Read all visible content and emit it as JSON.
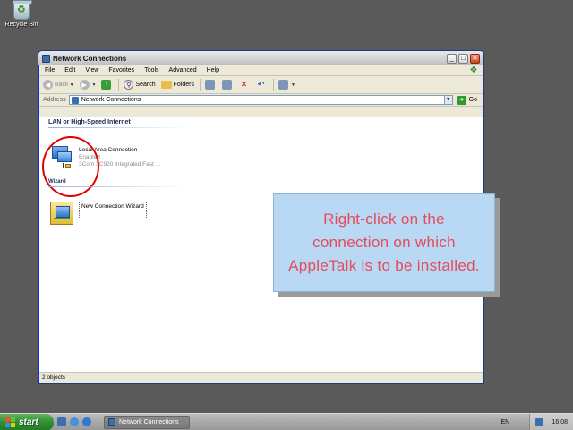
{
  "desktop": {
    "recycle_bin_label": "Recycle Bin",
    "recycle_bin_icon": "recycle-bin-icon"
  },
  "window": {
    "title": "Network Connections",
    "controls": {
      "minimize": "_",
      "maximize": "□",
      "close": "✕"
    }
  },
  "menubar": {
    "file": "File",
    "edit": "Edit",
    "view": "View",
    "favorites": "Favorites",
    "tools": "Tools",
    "advanced": "Advanced",
    "help": "Help"
  },
  "toolbar": {
    "back_label": "Back",
    "search_label": "Search",
    "folders_label": "Folders"
  },
  "addressbar": {
    "label": "Address",
    "value": "Network Connections",
    "go_label": "Go"
  },
  "content": {
    "group_lan": "LAN or High-Speed Internet",
    "group_wizard": "Wizard",
    "lan_connection": {
      "name": "Local Area Connection",
      "status": "Enabled",
      "device": "3Com 3C920 Integrated Fast ..."
    },
    "wizard_item": {
      "name": "New Connection Wizard"
    }
  },
  "callout": {
    "text": "Right-click on the connection on which AppleTalk is to be installed.",
    "text_color": "#e64b5a",
    "background": "#b8d8f4"
  },
  "statusbar": {
    "text": "2 objects"
  },
  "taskbar": {
    "start_label": "start",
    "task_label": "Network Connections",
    "language": "EN",
    "clock": "16:08"
  },
  "colors": {
    "desktop": "#5a5a5a",
    "annotation_circle": "#e00000"
  }
}
